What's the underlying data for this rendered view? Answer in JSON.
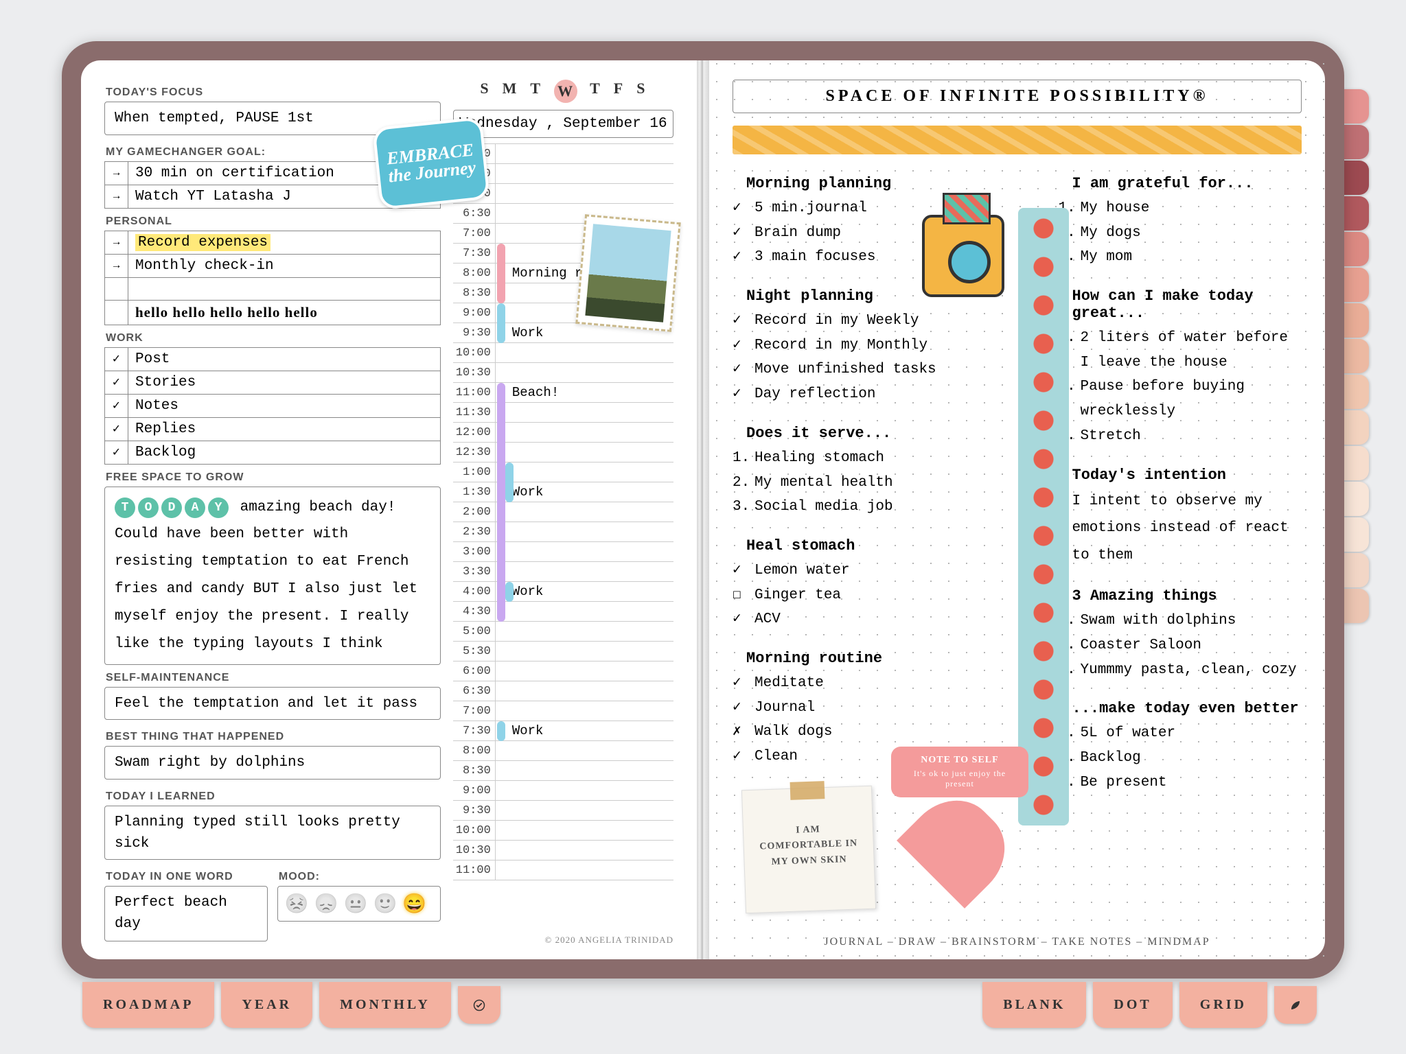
{
  "week": {
    "days": [
      "S",
      "M",
      "T",
      "W",
      "T",
      "F",
      "S"
    ],
    "selected": 3
  },
  "date": "Wednesday , September 16",
  "left": {
    "focus": {
      "h": "TODAY'S FOCUS",
      "v": "When tempted, PAUSE 1st"
    },
    "goal": {
      "h": "MY GAMECHANGER GOAL:",
      "items": [
        {
          "mark": "→",
          "t": "30 min on certification"
        },
        {
          "mark": "→",
          "t": "Watch YT Latasha J"
        }
      ]
    },
    "personal": {
      "h": "PERSONAL",
      "items": [
        {
          "mark": "→",
          "t": "Record expenses",
          "hl": true
        },
        {
          "mark": "→",
          "t": "Monthly check-in"
        },
        {
          "mark": "",
          "t": ""
        },
        {
          "mark": "",
          "t": "hello hello hello hello hello",
          "hw": true
        }
      ]
    },
    "work": {
      "h": "WORK",
      "items": [
        {
          "mark": "✓",
          "t": "Post"
        },
        {
          "mark": "✓",
          "t": "Stories"
        },
        {
          "mark": "✓",
          "t": "Notes"
        },
        {
          "mark": "✓",
          "t": "Replies"
        },
        {
          "mark": "✓",
          "t": "Backlog"
        }
      ]
    },
    "free": {
      "h": "FREE SPACE TO GROW",
      "badge": "TODAY",
      "v": "amazing beach day! Could have been better with resisting temptation to eat French fries and candy BUT I also just let myself enjoy the present. I really like the typing layouts I think"
    },
    "selfm": {
      "h": "SELF-MAINTENANCE",
      "v": "Feel the temptation and let it pass"
    },
    "best": {
      "h": "BEST THING THAT HAPPENED",
      "v": "Swam right by dolphins"
    },
    "learned": {
      "h": "TODAY I LEARNED",
      "v": "Planning typed still looks pretty sick"
    },
    "word": {
      "h": "TODAY IN ONE WORD",
      "v": "Perfect beach day"
    },
    "mood": {
      "h": "MOOD:",
      "faces": [
        "😣",
        "😞",
        "😐",
        "🙂",
        "😄"
      ],
      "sel": 4
    }
  },
  "schedule": {
    "times": [
      "5:00",
      "5:30",
      "6:00",
      "6:30",
      "7:00",
      "7:30",
      "8:00",
      "8:30",
      "9:00",
      "9:30",
      "10:00",
      "10:30",
      "11:00",
      "11:30",
      "12:00",
      "12:30",
      "1:00",
      "1:30",
      "2:00",
      "2:30",
      "3:00",
      "3:30",
      "4:00",
      "4:30",
      "5:00",
      "5:30",
      "6:00",
      "6:30",
      "7:00",
      "7:30",
      "8:00",
      "8:30",
      "9:00",
      "9:30",
      "10:00",
      "10:30",
      "11:00"
    ],
    "events": {
      "6": "Morning routine",
      "9": "Work",
      "12": "Beach!",
      "17": "Work",
      "22": "Work",
      "29": "Work"
    },
    "bars": [
      {
        "from": 5,
        "to": 8,
        "c": "#f2a3b0"
      },
      {
        "from": 8,
        "to": 10,
        "c": "#8fd3e8"
      },
      {
        "from": 12,
        "to": 24,
        "c": "#c9a8f0"
      },
      {
        "from": 16,
        "to": 18,
        "c": "#8fd3e8",
        "off": 12
      },
      {
        "from": 22,
        "to": 23,
        "c": "#8fd3e8",
        "off": 12
      },
      {
        "from": 29,
        "to": 30,
        "c": "#8fd3e8"
      }
    ]
  },
  "copyright": "© 2020 ANGELIA TRINIDAD",
  "right": {
    "title": "SPACE OF INFINITE POSSIBILITY®",
    "colL": [
      {
        "h": "Morning planning",
        "items": [
          {
            "m": "✓",
            "t": "5 min.journal"
          },
          {
            "m": "✓",
            "t": "Brain dump"
          },
          {
            "m": "✓",
            "t": "3 main focuses"
          }
        ]
      },
      {
        "h": "Night planning",
        "items": [
          {
            "m": "✓",
            "t": "Record in my Weekly"
          },
          {
            "m": "✓",
            "t": "Record in my Monthly"
          },
          {
            "m": "✓",
            "t": "Move unfinished tasks"
          },
          {
            "m": "✓",
            "t": "Day reflection"
          }
        ]
      },
      {
        "h": "Does it serve...",
        "items": [
          {
            "m": "1.",
            "t": "Healing stomach"
          },
          {
            "m": "2.",
            "t": "My mental health"
          },
          {
            "m": "3.",
            "t": "Social media job"
          }
        ]
      },
      {
        "h": "Heal stomach",
        "items": [
          {
            "m": "✓",
            "t": "Lemon water"
          },
          {
            "m": "☐",
            "t": "Ginger tea"
          },
          {
            "m": "✓",
            "t": "ACV"
          }
        ]
      },
      {
        "h": "Morning routine",
        "items": [
          {
            "m": "✓",
            "t": "Meditate"
          },
          {
            "m": "✓",
            "t": "Journal"
          },
          {
            "m": "✗",
            "t": "Walk dogs"
          },
          {
            "m": "✓",
            "t": "Clean"
          }
        ]
      }
    ],
    "colR": [
      {
        "h": "I am grateful for...",
        "items": [
          {
            "m": "1.",
            "t": "My house"
          },
          {
            "m": "2.",
            "t": "My dogs"
          },
          {
            "m": "3.",
            "t": "My mom"
          }
        ]
      },
      {
        "h": "How can I make today great...",
        "items": [
          {
            "m": "1.",
            "t": "2 liters of water before I leave the house"
          },
          {
            "m": "2.",
            "t": "Pause before buying wrecklessly"
          },
          {
            "m": "3.",
            "t": "Stretch"
          }
        ]
      },
      {
        "h": "Today's intention",
        "plain": "I intent to observe my emotions instead of react to them"
      },
      {
        "h": "3 Amazing things",
        "items": [
          {
            "m": "1.",
            "t": "Swam with dolphins"
          },
          {
            "m": "2.",
            "t": "Coaster Saloon"
          },
          {
            "m": "3.",
            "t": "Yummmy pasta, clean, cozy"
          }
        ]
      },
      {
        "h": "...make today even better",
        "items": [
          {
            "m": "1.",
            "t": "5L of water"
          },
          {
            "m": "2.",
            "t": "Backlog"
          },
          {
            "m": "3.",
            "t": "Be present"
          }
        ]
      }
    ],
    "foot": "JOURNAL – DRAW – BRAINSTORM – TAKE NOTES – MINDMAP"
  },
  "stickers": {
    "embrace": "EMBRACE the Journey",
    "note_title": "NOTE TO SELF",
    "note_body": "It's ok to just enjoy the present",
    "affirm": "I AM COMFORTABLE IN MY OWN SKIN"
  },
  "tabs_side": [
    "#e59391",
    "#bf7074",
    "#9d4a51",
    "#b1595e",
    "#dc8a83",
    "#e7a091",
    "#e9ad97",
    "#ecb9a2",
    "#f0c6af",
    "#f3d3bf",
    "#f6ddcd",
    "#f8e5d8",
    "#f7e4d7",
    "#f2d6c6",
    "#ecc5b2"
  ],
  "tabs_bottom_l": [
    "ROADMAP",
    "YEAR",
    "MONTHLY"
  ],
  "tabs_bottom_r": [
    "BLANK",
    "DOT",
    "GRID"
  ]
}
